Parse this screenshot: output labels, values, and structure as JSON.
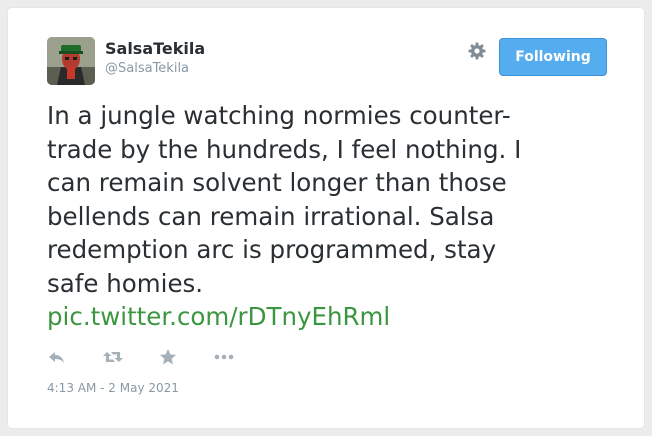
{
  "tweet": {
    "display_name": "SalsaTekila",
    "handle": "@SalsaTekila",
    "follow_button_label": "Following",
    "text_lines": [
      "In a jungle watching normies counter-",
      "trade by the hundreds, I feel nothing. I",
      "can remain solvent longer than those",
      "bellends can remain irrational. Salsa",
      "redemption arc is programmed, stay",
      "safe homies."
    ],
    "link": "pic.twitter.com/rDTnyEhRml",
    "timestamp": "4:13 AM - 2 May 2021"
  },
  "icons": {
    "settings": "gear-icon",
    "reply": "reply-icon",
    "retweet": "retweet-icon",
    "favorite": "star-icon",
    "more": "more-icon"
  },
  "colors": {
    "follow_button": "#55acee",
    "link": "#3b9640",
    "text": "#292f33",
    "muted": "#8899a6",
    "icon": "#a5b0b9"
  }
}
